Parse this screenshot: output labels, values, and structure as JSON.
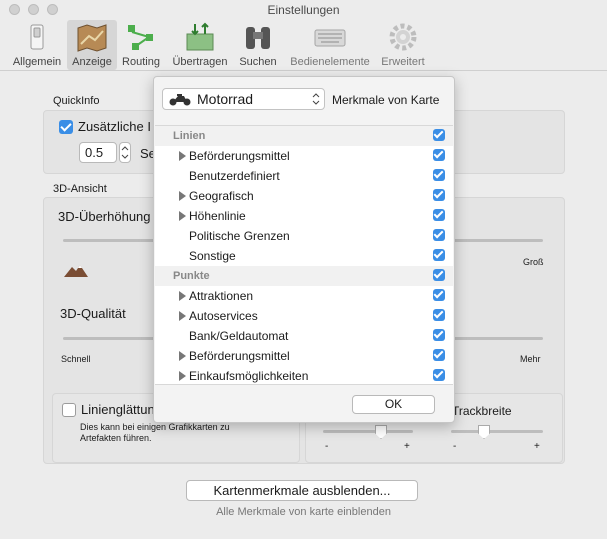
{
  "window": {
    "title": "Einstellungen"
  },
  "toolbar": {
    "tabs": [
      {
        "label": "Allgemein"
      },
      {
        "label": "Anzeige"
      },
      {
        "label": "Routing"
      },
      {
        "label": "Übertragen"
      },
      {
        "label": "Suchen"
      },
      {
        "label": "Bedienelemente"
      },
      {
        "label": "Erweitert"
      }
    ],
    "selected": "Anzeige"
  },
  "quickinfo": {
    "label": "QuickInfo",
    "checkbox_label": "Zusätzliche I",
    "checked": true,
    "delay_value": "0.5",
    "delay_unit": "Se"
  },
  "view3d": {
    "label": "3D-Ansicht",
    "elevation_label": "3D-Überhöhung",
    "elevation_right": "Groß",
    "quality_label": "3D-Qualität",
    "quality_left": "Schnell",
    "quality_right": "Mehr",
    "smoothing_label": "Linienglättun",
    "smoothing_checked": false,
    "smoothing_note": "Dies kann bei einigen Grafikkarten zu Artefakten führen.",
    "track_width_label": "Trackbreite",
    "minus": "-",
    "plus": "+"
  },
  "popover": {
    "vehicle": "Motorrad",
    "heading": "Merkmale von Karte",
    "rows": [
      {
        "label": "Linien",
        "header": true,
        "checked": true
      },
      {
        "label": "Beförderungsmittel",
        "expandable": true,
        "checked": true
      },
      {
        "label": "Benutzerdefiniert",
        "checked": true
      },
      {
        "label": "Geografisch",
        "expandable": true,
        "checked": true
      },
      {
        "label": "Höhenlinie",
        "expandable": true,
        "checked": true
      },
      {
        "label": "Politische Grenzen",
        "checked": true
      },
      {
        "label": "Sonstige",
        "checked": true
      },
      {
        "label": "Punkte",
        "header": true,
        "checked": true
      },
      {
        "label": "Attraktionen",
        "expandable": true,
        "checked": true
      },
      {
        "label": "Autoservices",
        "expandable": true,
        "checked": true
      },
      {
        "label": "Bank/Geldautomat",
        "checked": true
      },
      {
        "label": "Beförderungsmittel",
        "expandable": true,
        "checked": true
      },
      {
        "label": "Einkaufsmöglichkeiten",
        "expandable": true,
        "checked": true
      }
    ],
    "ok": "OK"
  },
  "footer": {
    "hide_button": "Kartenmerkmale ausblenden...",
    "hint": "Alle Merkmale von karte einblenden"
  },
  "colors": {
    "accent": "#3a8ee6"
  }
}
